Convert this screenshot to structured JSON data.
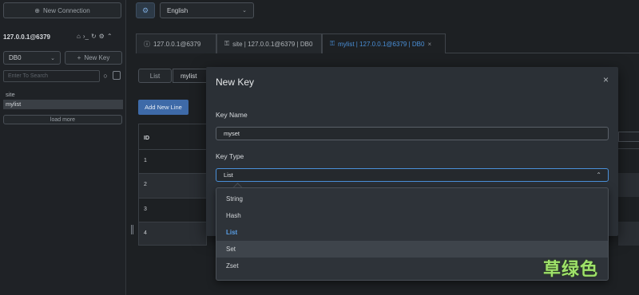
{
  "sidebar": {
    "new_connection_label": "New Connection",
    "connection_name": "127.0.0.1@6379",
    "db_select_value": "DB0",
    "new_key_label": "New Key",
    "search_placeholder": "Enter To Search",
    "keys": [
      "site",
      "mylist"
    ],
    "load_more_label": "load more"
  },
  "topbar": {
    "language_value": "English"
  },
  "tabs": [
    {
      "label": "127.0.0.1@6379"
    },
    {
      "label": "site | 127.0.0.1@6379 | DB0"
    },
    {
      "label": "mylist | 127.0.0.1@6379 | DB0",
      "close": "×"
    }
  ],
  "key_view": {
    "type_label": "List",
    "key_name": "mylist",
    "add_line_label": "Add New Line",
    "id_header": "ID",
    "rows": [
      "1",
      "2",
      "3",
      "4"
    ]
  },
  "modal": {
    "title": "New Key",
    "close": "×",
    "key_name_label": "Key Name",
    "key_name_value": "myset",
    "key_type_label": "Key Type",
    "key_type_value": "List",
    "options": [
      "String",
      "Hash",
      "List",
      "Set",
      "Zset"
    ]
  },
  "watermark": "草绿色",
  "colors": {
    "accent": "#4a90d9",
    "button_primary": "#3e6aa8",
    "watermark": "#9fe26a"
  }
}
